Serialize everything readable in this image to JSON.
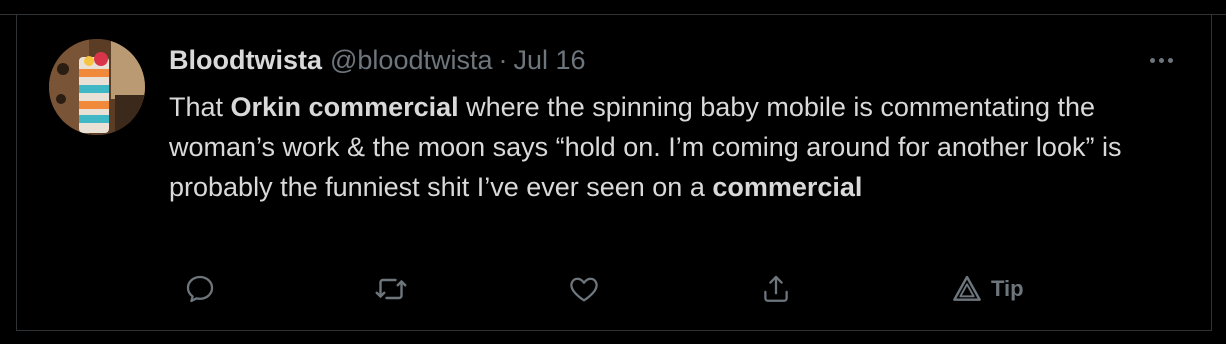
{
  "tweet": {
    "author_name": "Bloodtwista",
    "author_handle": "@bloodtwista",
    "separator": "·",
    "date": "Jul 16",
    "text_segments": [
      {
        "text": "That ",
        "bold": false
      },
      {
        "text": "Orkin commercial",
        "bold": true
      },
      {
        "text": " where the spinning baby mobile is commentating the woman’s work & the moon says “hold on. I’m coming around for another look” is probably the funniest shit I’ve ever seen on a ",
        "bold": false
      },
      {
        "text": "commercial",
        "bold": true
      }
    ]
  },
  "actions": {
    "reply_icon": "reply-icon",
    "retweet_icon": "retweet-icon",
    "like_icon": "heart-icon",
    "share_icon": "share-icon",
    "tip_icon": "tip-icon",
    "tip_label": "Tip"
  },
  "colors": {
    "background": "#000000",
    "text": "#d9d9d9",
    "muted": "#6e767d",
    "border": "#2f3336"
  }
}
